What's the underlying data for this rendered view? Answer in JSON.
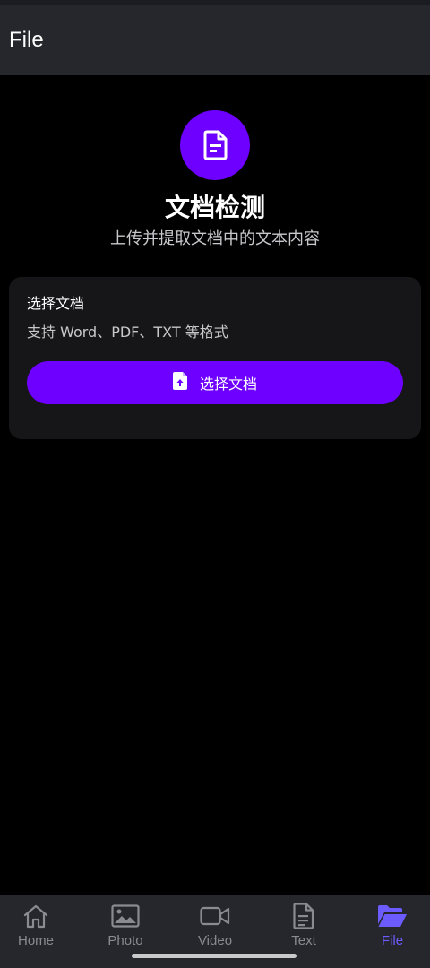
{
  "header": {
    "title": "File"
  },
  "hero": {
    "icon": "document-icon",
    "title": "文档检测",
    "subtitle": "上传并提取文档中的文本内容"
  },
  "card": {
    "title": "选择文档",
    "description": "支持 Word、PDF、TXT 等格式",
    "button_label": "选择文档",
    "button_icon": "file-upload-icon"
  },
  "colors": {
    "accent": "#6e00ff",
    "active_nav": "#6c5cff",
    "inactive_nav": "#8a8b90"
  },
  "nav": {
    "items": [
      {
        "label": "Home",
        "icon": "home-icon",
        "active": false
      },
      {
        "label": "Photo",
        "icon": "photo-icon",
        "active": false
      },
      {
        "label": "Video",
        "icon": "video-icon",
        "active": false
      },
      {
        "label": "Text",
        "icon": "text-document-icon",
        "active": false
      },
      {
        "label": "File",
        "icon": "folder-open-icon",
        "active": true
      }
    ]
  }
}
